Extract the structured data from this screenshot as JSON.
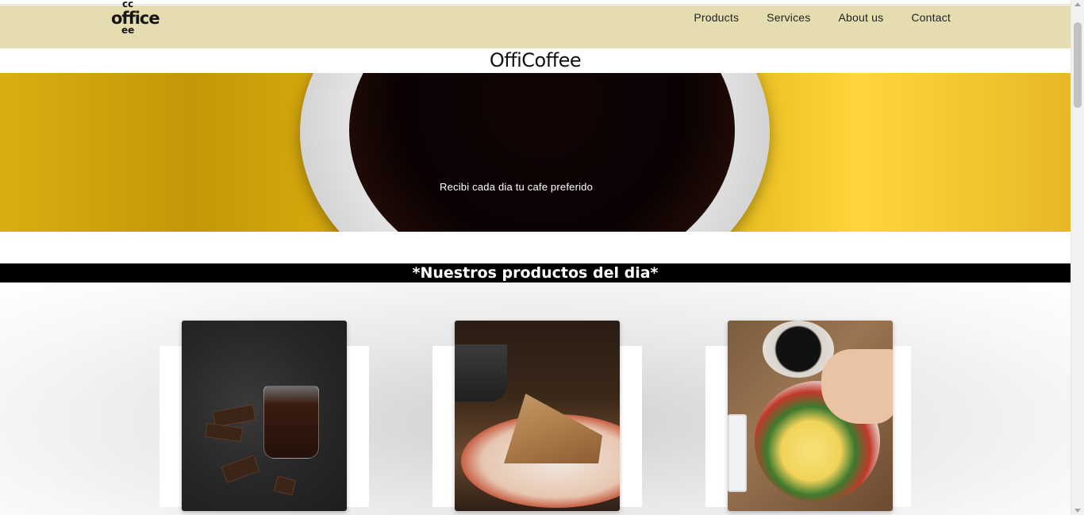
{
  "navbar": {
    "logo": {
      "word": "office",
      "cc_top": "cc",
      "cc_bottom": "ee"
    },
    "links": [
      "Products",
      "Services",
      "About us",
      "Contact"
    ]
  },
  "site_title": "OffiCoffee",
  "hero": {
    "text": "Recibi cada dia tu cafe preferido"
  },
  "products_section": {
    "heading": "*Nuestros productos del dia*"
  },
  "colors": {
    "navbar_bg": "#e5ddb0",
    "hero_yellow": "#e9bf22",
    "banner_bg": "#000000"
  }
}
